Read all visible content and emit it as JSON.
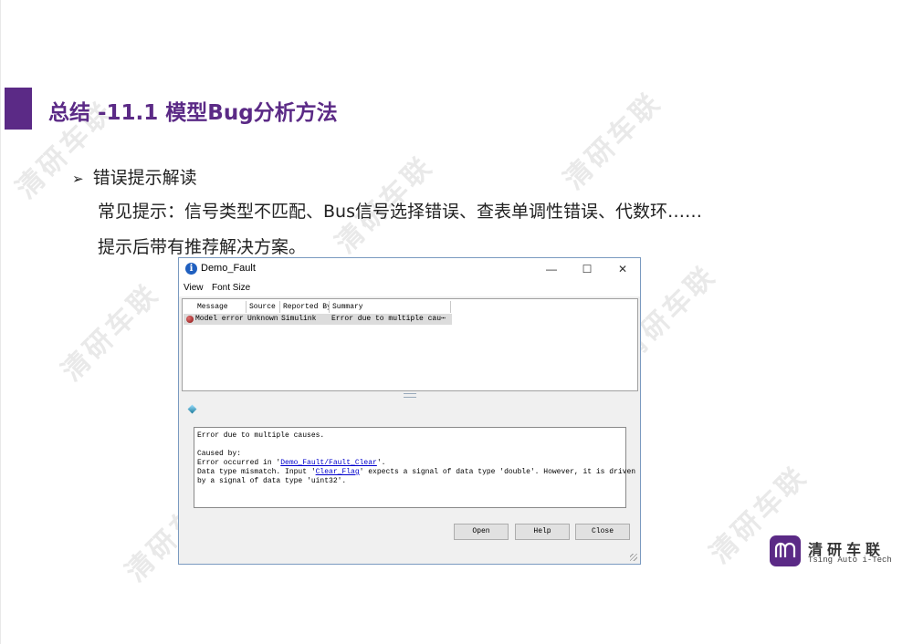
{
  "slide": {
    "title": "总结 -11.1 模型Bug分析方法",
    "bullet_marker": "➢",
    "bullet_text": "错误提示解读",
    "line2": "常见提示：信号类型不匹配、Bus信号选择错误、查表单调性错误、代数环……",
    "line3": "提示后带有推荐解决方案。",
    "watermark": "清研车联",
    "brand_name": "清研车联",
    "brand_sub": "Tsing Auto i-Tech"
  },
  "window": {
    "title": "Demo_Fault",
    "info_icon": "i",
    "minimize": "—",
    "maximize": "☐",
    "close": "✕",
    "menu": {
      "view": "View",
      "font_size": "Font Size"
    },
    "columns": [
      "Message",
      "Source",
      "Reported By",
      "Summary"
    ],
    "row": {
      "message": "Model error",
      "source": "Unknown",
      "reported_by": "Simulink",
      "summary": "Error due to multiple cau⋯"
    },
    "details": {
      "line1": "Error due to multiple causes.",
      "caused_by": "Caused by:",
      "line3_prefix": "Error occurred in '",
      "line3_link": "Demo_Fault/Fault_Clear",
      "line3_suffix": "'.",
      "line4_prefix": "Data type mismatch. Input '",
      "line4_link": "Clear_Flag",
      "line4_suffix": "' expects a signal of data type 'double'. However, it is driven",
      "line5": "by a signal of data type 'uint32'."
    },
    "buttons": {
      "open": "Open",
      "help": "Help",
      "close": "Close"
    }
  },
  "colors": {
    "accent": "#5b2a86",
    "link": "#0000cc"
  }
}
